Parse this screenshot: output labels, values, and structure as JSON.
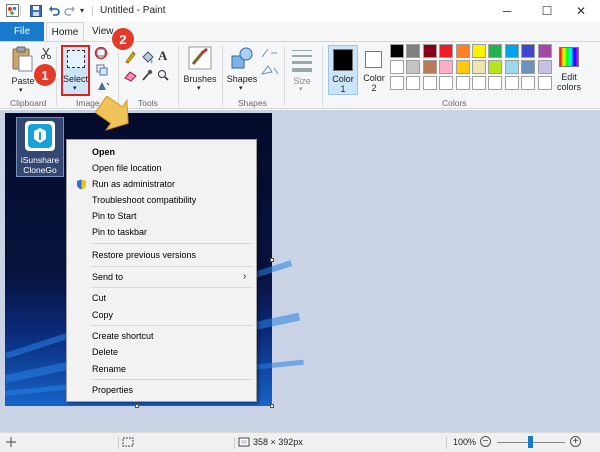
{
  "window": {
    "title": "Untitled - Paint",
    "controls": {
      "minimize": "─",
      "maximize": "☐",
      "close": "✕"
    }
  },
  "tabs": {
    "file": "File",
    "home": "Home",
    "view": "View"
  },
  "ribbon": {
    "clipboard": {
      "paste": "Paste",
      "label": "Clipboard"
    },
    "image": {
      "select": "Select",
      "label": "Image"
    },
    "tools": {
      "label": "Tools"
    },
    "brushes": {
      "label": "Brushes"
    },
    "shapes": {
      "shapes_btn": "Shapes",
      "label": "Shapes"
    },
    "size": {
      "label": "Size"
    },
    "colors": {
      "color1": "Color 1",
      "color2": "Color 2",
      "edit": "Edit colors",
      "label": "Colors",
      "color1_value": "#000000",
      "color2_value": "#ffffff",
      "row1": [
        "#000000",
        "#7f7f7f",
        "#880015",
        "#ed1c24",
        "#ff7f27",
        "#fff200",
        "#22b14c",
        "#00a2e8",
        "#3f48cc",
        "#a349a4"
      ],
      "row2": [
        "#ffffff",
        "#c3c3c3",
        "#b97a57",
        "#ffaec9",
        "#ffc90e",
        "#efe4b0",
        "#b5e61d",
        "#99d9ea",
        "#7092be",
        "#c8bfe7"
      ],
      "row3": [
        "#ffffff",
        "#ffffff",
        "#ffffff",
        "#ffffff",
        "#ffffff",
        "#ffffff",
        "#ffffff",
        "#ffffff",
        "#ffffff",
        "#ffffff"
      ]
    }
  },
  "canvas": {
    "icon_label_line1": "iSunshare",
    "icon_label_line2": "CloneGo"
  },
  "context_menu": {
    "items": [
      "Open",
      "Open file location",
      "Run as administrator",
      "Troubleshoot compatibility",
      "Pin to Start",
      "Pin to taskbar",
      "Restore previous versions",
      "Send to",
      "Cut",
      "Copy",
      "Create shortcut",
      "Delete",
      "Rename",
      "Properties"
    ]
  },
  "annotations": {
    "step1": "1",
    "step2": "2"
  },
  "status": {
    "image_size": "358 × 392px",
    "zoom": "100%"
  }
}
